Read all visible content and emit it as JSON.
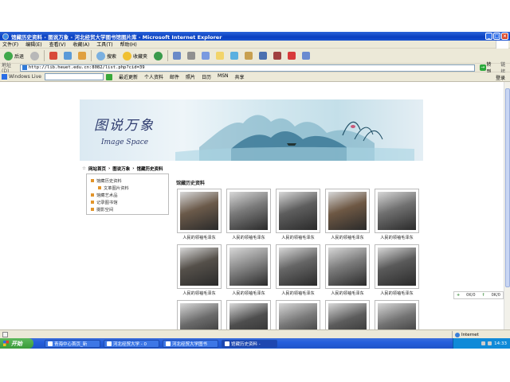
{
  "window": {
    "title": "馆藏历史资料 - 图说万象 - 河北经贸大学图书馆图片库 - Microsoft Internet Explorer",
    "controls": [
      "_",
      "□",
      "×"
    ]
  },
  "menu": [
    "文件(F)",
    "编辑(E)",
    "查看(V)",
    "收藏(A)",
    "工具(T)",
    "帮助(H)"
  ],
  "toolbar": {
    "back": "后退",
    "search": "搜索",
    "favorites": "收藏夹"
  },
  "address": {
    "label": "地址(D)",
    "url": "http://lib.heuet.edu.cn:8082/list.php?cid=39",
    "go": "转到",
    "links": "链接"
  },
  "live": {
    "label": "Windows Live",
    "buttons": [
      "最近更新",
      "个人资料",
      "邮件",
      "照片",
      "日历",
      "MSN",
      "共享"
    ],
    "signin": "登录"
  },
  "banner": {
    "title_cn": "图说万象",
    "title_en": "Image Space"
  },
  "breadcrumb": [
    "网站首页",
    "图说万象",
    "馆藏历史资料"
  ],
  "sidenav": [
    {
      "label": "馆藏历史资料",
      "sub": false
    },
    {
      "label": "文革图片资料",
      "sub": true
    },
    {
      "label": "馆藏艺术品",
      "sub": false
    },
    {
      "label": "记录图书馆",
      "sub": false
    },
    {
      "label": "摄影空间",
      "sub": false
    }
  ],
  "section_title": "馆藏历史资料",
  "photos": [
    {
      "caption": "人民的领袖毛泽东",
      "tone": "#6b5a4a"
    },
    {
      "caption": "人民的领袖毛泽东",
      "tone": "#7a7a7a"
    },
    {
      "caption": "人民的领袖毛泽东",
      "tone": "#5e5e5e"
    },
    {
      "caption": "人民的领袖毛泽东",
      "tone": "#6e5844"
    },
    {
      "caption": "人民的领袖毛泽东",
      "tone": "#707070"
    },
    {
      "caption": "人民的领袖毛泽东",
      "tone": "#55504a"
    },
    {
      "caption": "人民的领袖毛泽东",
      "tone": "#8a8a8a"
    },
    {
      "caption": "人民的领袖毛泽东",
      "tone": "#666666"
    },
    {
      "caption": "人民的领袖毛泽东",
      "tone": "#7c7c7c"
    },
    {
      "caption": "人民的领袖毛泽东",
      "tone": "#5a5a5a"
    },
    {
      "caption": "",
      "tone": "#6a6a6a"
    },
    {
      "caption": "",
      "tone": "#4e4e4e"
    },
    {
      "caption": "",
      "tone": "#787878"
    },
    {
      "caption": "",
      "tone": "#5c5c5c"
    },
    {
      "caption": "",
      "tone": "#727272"
    }
  ],
  "mininote": {
    "left": "0K/0",
    "right": "0K/0"
  },
  "status": {
    "zone": "Internet"
  },
  "taskbar": {
    "start": "开始",
    "tasks": [
      "青海中心首页_新",
      "河北经贸大学 - 0",
      "河北经贸大学图书",
      "馆藏历史资料 -"
    ],
    "clock": "14:33"
  }
}
